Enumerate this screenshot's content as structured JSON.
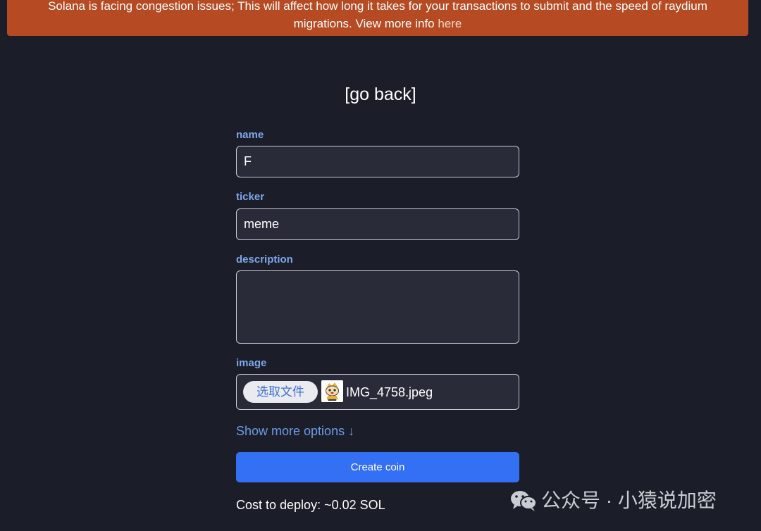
{
  "banner": {
    "text_line1": "Solana is facing congestion issues; This will affect how long it takes for your transactions to submit and the speed of raydium",
    "text_line2": "migrations. View more info ",
    "link_label": "here"
  },
  "nav": {
    "go_back_label": "[go back]"
  },
  "form": {
    "name": {
      "label": "name",
      "value": "F"
    },
    "ticker": {
      "label": "ticker",
      "value": "meme"
    },
    "description": {
      "label": "description",
      "value": ""
    },
    "image": {
      "label": "image",
      "choose_button_label": "选取文件",
      "file_name": "IMG_4758.jpeg"
    },
    "more_options_label": "Show more options ↓",
    "submit_label": "Create coin",
    "cost_text": "Cost to deploy: ~0.02 SOL"
  },
  "watermark": {
    "text": "公众号 · 小猿说加密"
  },
  "colors": {
    "background": "#1b1d28",
    "banner": "#b54a23",
    "label": "#7ea6ea",
    "link": "#6d9be6",
    "primary_button": "#3470f3"
  },
  "icons": {
    "thumbnail": "meme-image-thumbnail",
    "watermark": "wechat-icon"
  }
}
